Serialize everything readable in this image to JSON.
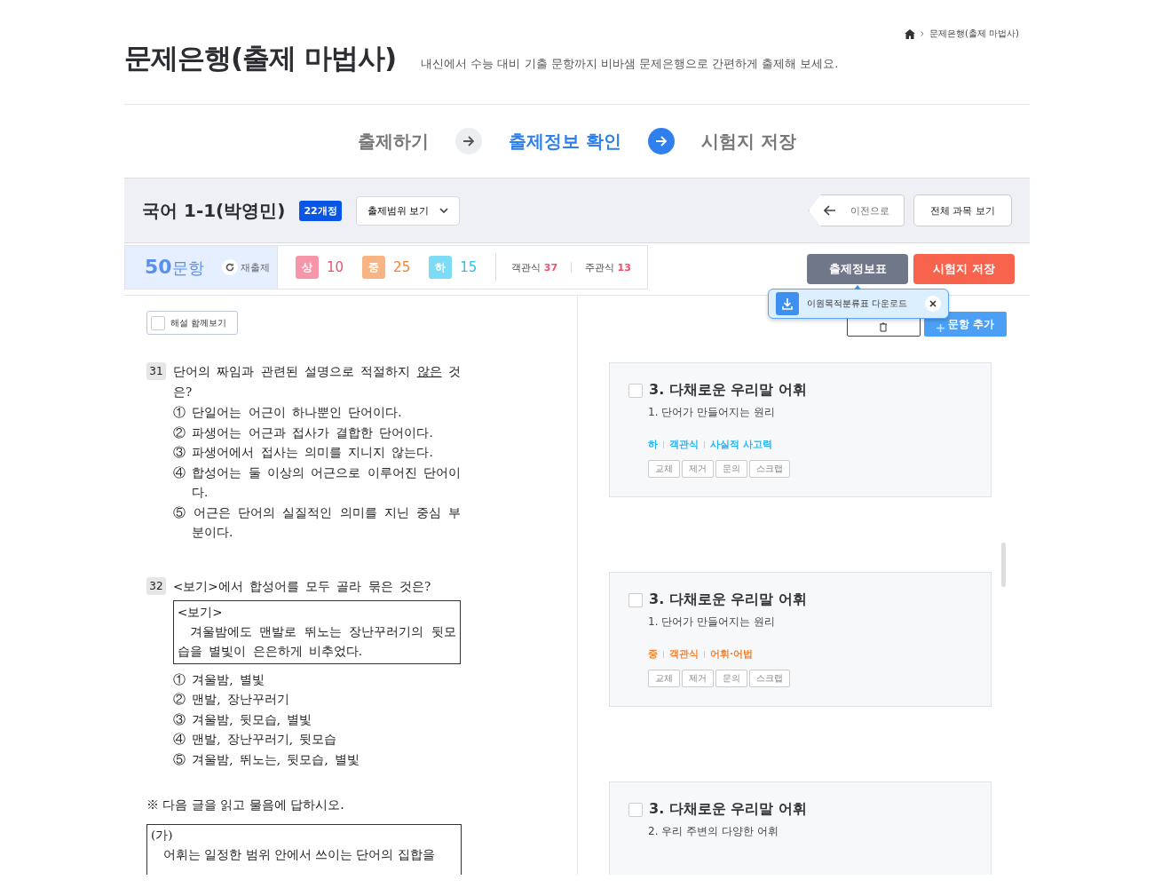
{
  "breadcrumb": {
    "current": "문제은행(출제 마법사)"
  },
  "header": {
    "title": "문제은행(출제 마법사)",
    "subtitle": "내신에서 수능 대비 기출 문항까지 비바샘 문제은행으로 간편하게 출제해 보세요."
  },
  "steps": [
    {
      "label": "출제하기",
      "selected": false
    },
    {
      "label": "출제정보 확인",
      "selected": true
    },
    {
      "label": "시험지 저장",
      "selected": false
    }
  ],
  "textbook": {
    "title": "국어 1-1(박영민)",
    "badge": "22개정",
    "scope_button": "출제범위 보기",
    "back_button": "이전으로",
    "all_subjects_button": "전체 과목 보기"
  },
  "summary": {
    "count": "50",
    "count_unit": "문항",
    "reissue": "재출제",
    "levels": [
      {
        "label": "상",
        "count": "10",
        "color": "#f0506e"
      },
      {
        "label": "중",
        "count": "25",
        "color": "#f58232"
      },
      {
        "label": "하",
        "count": "15",
        "color": "#28c3f0"
      }
    ],
    "types": [
      {
        "label": "객관식",
        "count": "37"
      },
      {
        "label": "주관식",
        "count": "13"
      }
    ]
  },
  "actions": {
    "info_table": "출제정보표",
    "save": "시험지 저장",
    "add": "문항 추가"
  },
  "popover": {
    "text": "이원목적분류표 다운로드"
  },
  "explain_toggle": {
    "label": "해설 함께보기",
    "checked": false
  },
  "left_items": [
    {
      "kind": "question",
      "number": "31",
      "stem": [
        {
          "text": "단어의 짜임과 관련된 설명으로 적절하지 ",
          "underline": false
        },
        {
          "text": "않은",
          "underline": true
        },
        {
          "text": " 것은?",
          "underline": false
        }
      ],
      "choices": [
        "① 단일어는 어근이 하나뿐인 단어이다.",
        "② 파생어는 어근과 접사가 결합한 단어이다.",
        "③ 파생어에서 접사는 의미를 지니지 않는다.",
        "④ 합성어는 둘 이상의 어근으로 이루어진 단어이다.",
        "⑤ 어근은 단어의 실질적인 의미를 지닌 중심 부분이다."
      ]
    },
    {
      "kind": "question",
      "number": "32",
      "stem": [
        {
          "text": "<보기>에서 합성어를 모두 골라 묶은 것은?",
          "underline": false
        }
      ],
      "box": {
        "title": "<보기>",
        "text": "겨울밤에도 맨발로 뛰노는 장난꾸러기의 뒷모습을 별빛이 은은하게 비추었다."
      },
      "choices": [
        "① 겨울밤, 별빛",
        "② 맨발, 장난꾸러기",
        "③ 겨울밤, 뒷모습, 별빛",
        "④ 맨발, 장난꾸러기, 뒷모습",
        "⑤ 겨울밤, 뛰노는, 뒷모습, 별빛"
      ]
    },
    {
      "kind": "instruction",
      "text": "※ 다음 글을 읽고 물음에 답하시오."
    },
    {
      "kind": "passage",
      "label": "(가)",
      "text": "어휘는 일정한 범위 안에서 쓰이는 단어의 집합을"
    }
  ],
  "cards": [
    {
      "checked": false,
      "title": "3. 다채로운 우리말 어휘",
      "subtitle": "1. 단어가 만들어지는 원리",
      "color": "#28b4f0",
      "tags": [
        "하",
        "객관식",
        "사실적 사고력"
      ],
      "buttons": [
        "교체",
        "제거",
        "문의",
        "스크랩"
      ]
    },
    {
      "checked": false,
      "title": "3. 다채로운 우리말 어휘",
      "subtitle": "1. 단어가 만들어지는 원리",
      "color": "#f58232",
      "tags": [
        "중",
        "객관식",
        "어휘·어법"
      ],
      "buttons": [
        "교체",
        "제거",
        "문의",
        "스크랩"
      ]
    },
    {
      "checked": false,
      "title": "3. 다채로운 우리말 어휘",
      "subtitle": "2. 우리 주변의 다양한 어휘"
    }
  ]
}
